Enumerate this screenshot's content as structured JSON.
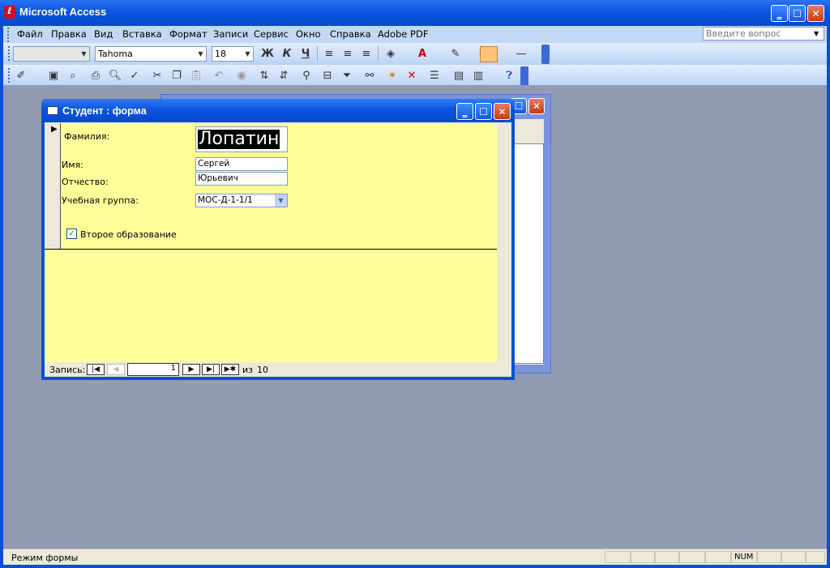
{
  "window": {
    "title": "Microsoft Access"
  },
  "menu": [
    "Файл",
    "Правка",
    "Вид",
    "Вставка",
    "Формат",
    "Записи",
    "Сервис",
    "Окно",
    "Справка",
    "Adobe PDF"
  ],
  "help": {
    "placeholder": "Введите вопрос"
  },
  "format_toolbar": {
    "font": "Tahoma",
    "size": "18",
    "bold": "Ж",
    "italic": "К",
    "underline": "Ч"
  },
  "form": {
    "title": "Студент : форма",
    "fields": {
      "surname_label": "Фамилия:",
      "surname_value": "Лопатин",
      "name_label": "Имя:",
      "name_value": "Сергей",
      "patronymic_label": "Отчество:",
      "patronymic_value": "Юрьевич",
      "group_label": "Учебная группа:",
      "group_value": "МОС-Д-1-1/1",
      "second_edu_label": "Второе образование",
      "second_edu_checked": true
    },
    "nav": {
      "label": "Запись:",
      "current": "1",
      "of": "из",
      "total": "10"
    }
  },
  "status": {
    "mode": "Режим формы",
    "num": "NUM"
  },
  "colors": {
    "title_blue": "#0a55e0",
    "form_bg": "#ffff99",
    "mdi_bg": "#919bb1"
  }
}
